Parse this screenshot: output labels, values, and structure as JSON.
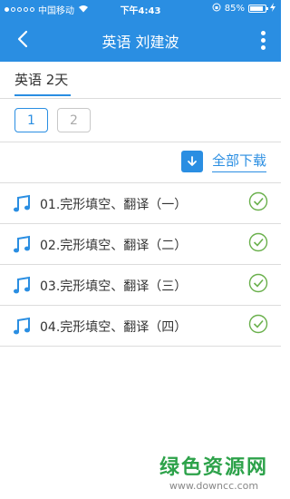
{
  "status": {
    "carrier": "中国移动",
    "time": "下午4:43",
    "battery": "85%",
    "battery_level": 0.85
  },
  "header": {
    "title": "英语 刘建波"
  },
  "subtab": {
    "label": "英语 2天"
  },
  "pages": [
    "1",
    "2"
  ],
  "download": {
    "label": "全部下载"
  },
  "items": [
    {
      "label": "01.完形填空、翻译（一）"
    },
    {
      "label": "02.完形填空、翻译（二）"
    },
    {
      "label": "03.完形填空、翻译（三）"
    },
    {
      "label": "04.完形填空、翻译（四）"
    }
  ],
  "watermark": {
    "main": "绿色资源网",
    "sub": "www.downcc.com"
  },
  "colors": {
    "primary": "#2a8ee2",
    "check": "#6ab04c"
  }
}
